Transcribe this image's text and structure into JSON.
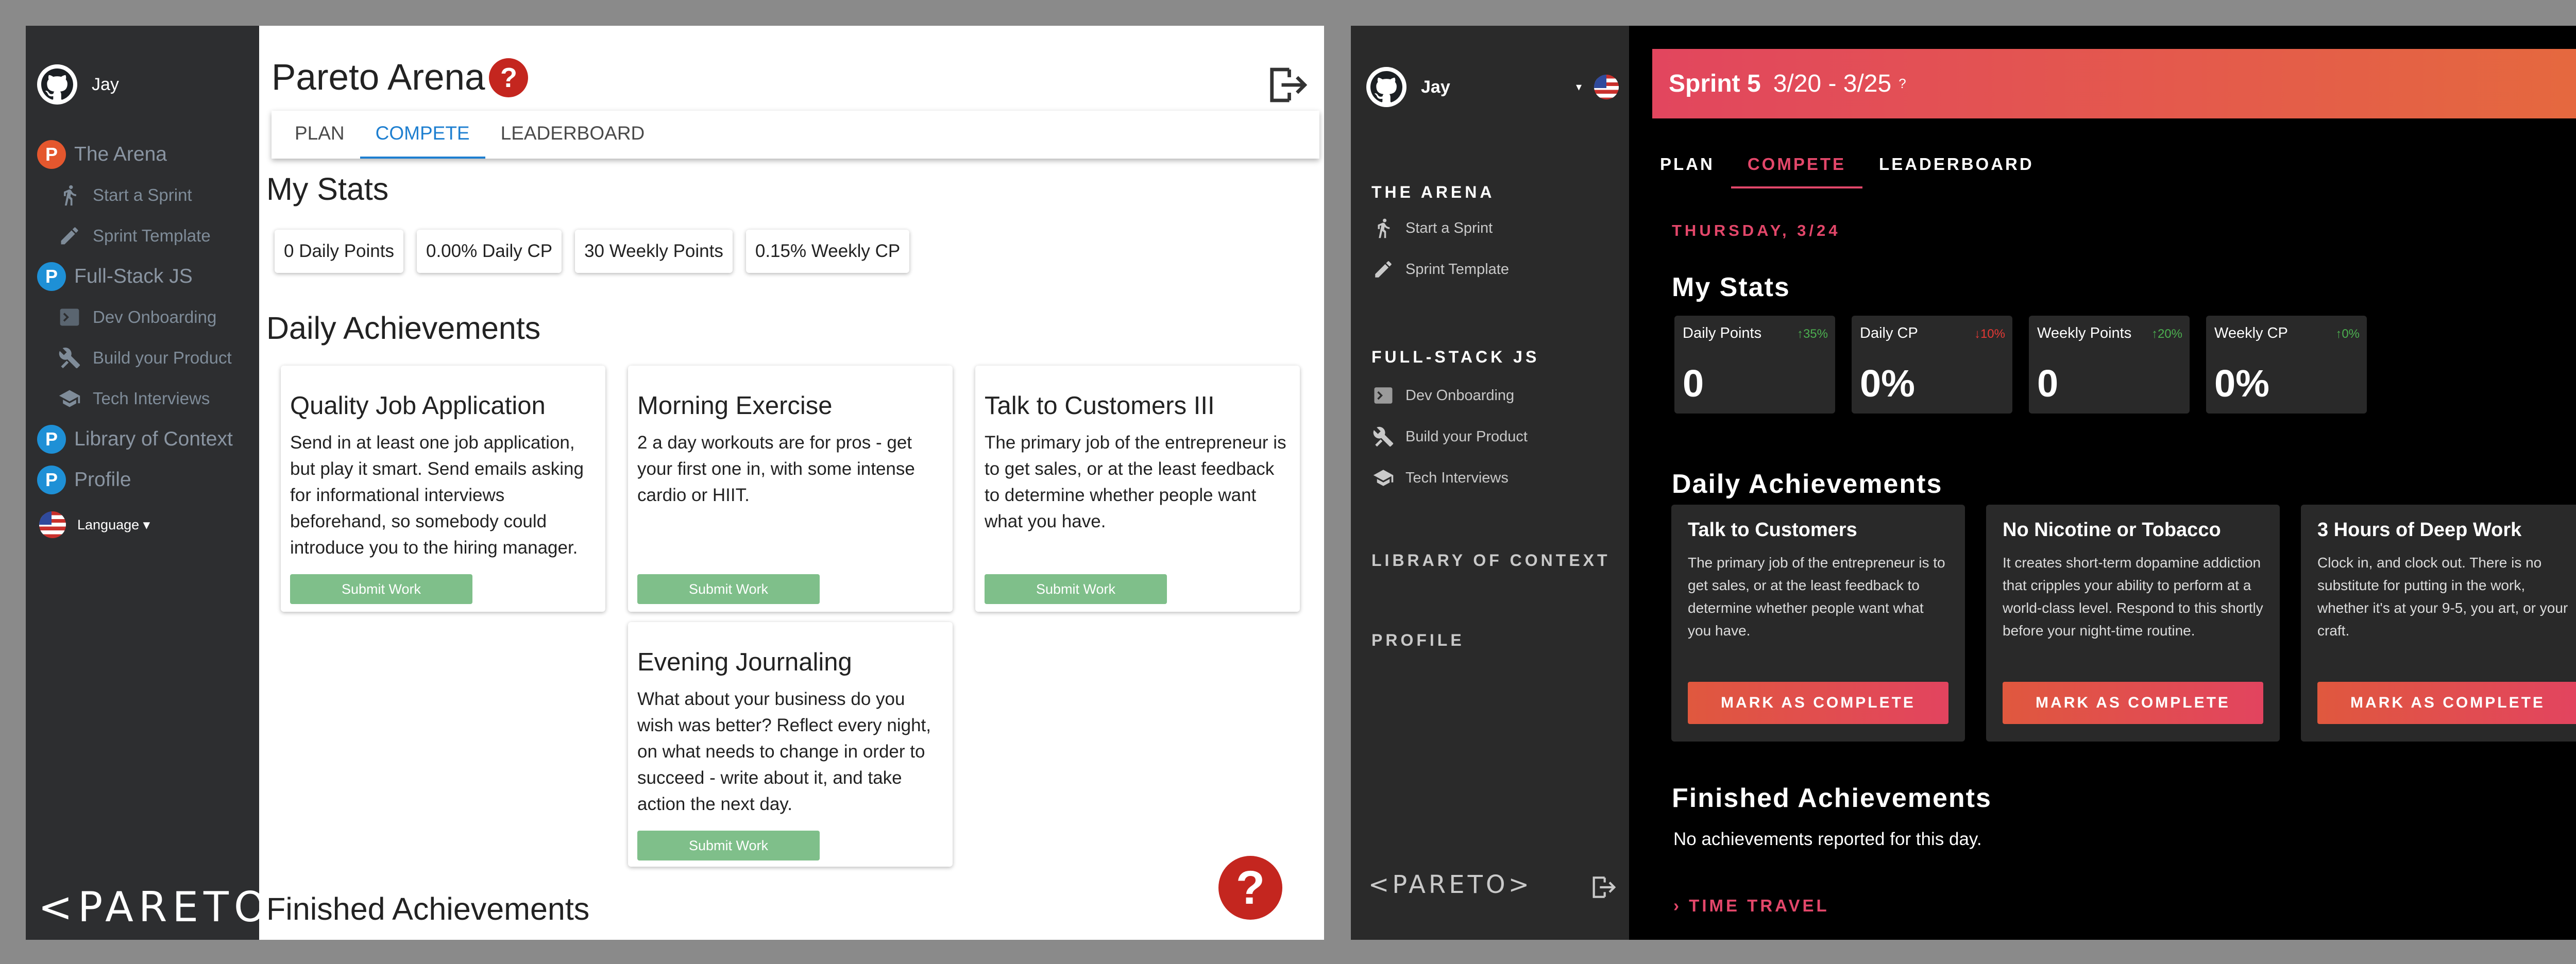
{
  "light": {
    "sidebar": {
      "user_name": "Jay",
      "nav": [
        {
          "label": "The Arena",
          "sub": [
            "Start a Sprint",
            "Sprint Template"
          ]
        },
        {
          "label": "Full-Stack JS",
          "sub": [
            "Dev Onboarding",
            "Build your Product",
            "Tech Interviews"
          ]
        },
        {
          "label": "Library of Context"
        },
        {
          "label": "Profile"
        }
      ],
      "language_label": "Language ▾",
      "logo_text": "<PARETO>"
    },
    "header": {
      "title": "Pareto Arena",
      "help_glyph": "?"
    },
    "tabs": [
      {
        "label": "PLAN"
      },
      {
        "label": "COMPETE"
      },
      {
        "label": "LEADERBOARD"
      }
    ],
    "active_tab": "COMPETE",
    "my_stats": {
      "heading": "My Stats",
      "items": [
        "0 Daily Points",
        "0.00% Daily CP",
        "30 Weekly Points",
        "0.15% Weekly CP"
      ]
    },
    "daily": {
      "heading": "Daily Achievements",
      "cards": [
        {
          "title": "Quality Job Application",
          "desc": "Send in at least one job application, but play it smart. Send emails asking for informational interviews beforehand, so somebody could introduce you to the hiring manager.",
          "button": "Submit Work"
        },
        {
          "title": "Morning Exercise",
          "desc": "2 a day workouts are for pros - get your first one in, with some intense cardio or HIIT.",
          "button": "Submit Work"
        },
        {
          "title": "Talk to Customers III",
          "desc": "The primary job of the entrepreneur is to get sales, or at the least feedback to determine whether people want what you have.",
          "button": "Submit Work"
        },
        {
          "title": "Evening Journaling",
          "desc": "What about your business do you wish was better? Reflect every night, on what needs to change in order to succeed - write about it, and take action the next day.",
          "button": "Submit Work"
        }
      ]
    },
    "finished": {
      "heading": "Finished Achievements"
    },
    "help_fab": "?"
  },
  "dark": {
    "sidebar": {
      "user_name": "Jay",
      "sections": [
        {
          "label": "THE ARENA",
          "sub": [
            "Start a Sprint",
            "Sprint Template"
          ]
        },
        {
          "label": "FULL-STACK JS",
          "sub": [
            "Dev Onboarding",
            "Build your Product",
            "Tech Interviews"
          ]
        },
        {
          "label": "LIBRARY OF CONTEXT"
        },
        {
          "label": "PROFILE"
        }
      ],
      "logo_text": "<PARETO>"
    },
    "banner": {
      "sprint": "Sprint 5",
      "dates": "3/20 - 3/25",
      "help_glyph": "?"
    },
    "tabs": [
      {
        "label": "PLAN"
      },
      {
        "label": "COMPETE"
      },
      {
        "label": "LEADERBOARD"
      }
    ],
    "active_tab": "COMPETE",
    "date_label": "THURSDAY, 3/24",
    "my_stats": {
      "heading": "My Stats",
      "items": [
        {
          "label": "Daily Points",
          "trend": "↑35%",
          "trend_color": "#4caf50",
          "value": "0"
        },
        {
          "label": "Daily CP",
          "trend": "↓10%",
          "trend_color": "#e53935",
          "value": "0%"
        },
        {
          "label": "Weekly Points",
          "trend": "↑20%",
          "trend_color": "#4caf50",
          "value": "0"
        },
        {
          "label": "Weekly CP",
          "trend": "↑0%",
          "trend_color": "#4caf50",
          "value": "0%"
        }
      ]
    },
    "daily": {
      "heading": "Daily Achievements",
      "cards": [
        {
          "title": "Talk to Customers",
          "desc": "The primary job of the entrepreneur is to get sales, or at the least feedback to determine whether people want what you have.",
          "button": "MARK AS COMPLETE"
        },
        {
          "title": "No Nicotine or Tobacco",
          "desc": "It creates short-term dopamine addiction that cripples your ability to perform at a world-class level. Respond to this shortly before your night-time routine.",
          "button": "MARK AS COMPLETE"
        },
        {
          "title": "3 Hours of Deep Work",
          "desc": "Clock in, and clock out. There is no substitute for putting in the work, whether it's at your 9-5, you art, or your craft.",
          "button": "MARK AS COMPLETE"
        }
      ]
    },
    "finished": {
      "heading": "Finished Achievements",
      "empty_text": "No achievements reported for this day."
    },
    "time_travel": "TIME TRAVEL",
    "help_glyph": "?"
  },
  "colors": {
    "light_accent": "#1e7fd0",
    "dark_accent": "#e3476a",
    "submit_green": "#7fbf8a",
    "help_red": "#c4261f"
  }
}
